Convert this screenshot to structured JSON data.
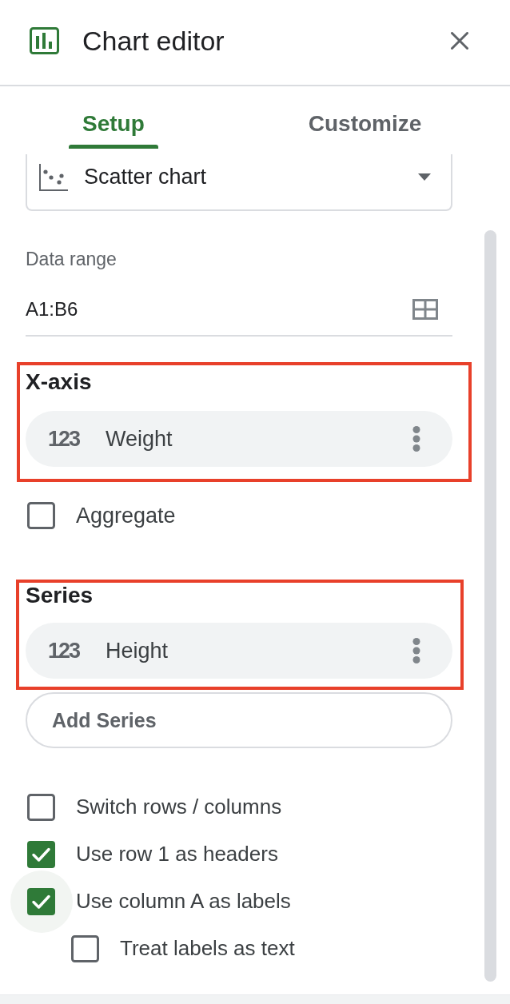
{
  "header": {
    "title": "Chart editor"
  },
  "tabs": [
    {
      "label": "Setup",
      "selected": true
    },
    {
      "label": "Customize",
      "selected": false
    }
  ],
  "chart_type": {
    "value": "Scatter chart"
  },
  "data_range": {
    "label": "Data range",
    "value": "A1:B6"
  },
  "x_axis": {
    "heading": "X-axis",
    "highlighted": true,
    "field": {
      "type_label": "123",
      "name": "Weight"
    }
  },
  "aggregate": {
    "label": "Aggregate",
    "checked": false
  },
  "series": {
    "heading": "Series",
    "highlighted": true,
    "items": [
      {
        "type_label": "123",
        "name": "Height"
      }
    ]
  },
  "add_series_button": "Add Series",
  "options": [
    {
      "label": "Switch rows / columns",
      "checked": false,
      "hovered": false
    },
    {
      "label": "Use row 1 as headers",
      "checked": true,
      "hovered": false
    },
    {
      "label": "Use column A as labels",
      "checked": true,
      "hovered": true,
      "children": [
        {
          "label": "Treat labels as text",
          "checked": false,
          "hovered": false
        }
      ]
    }
  ]
}
